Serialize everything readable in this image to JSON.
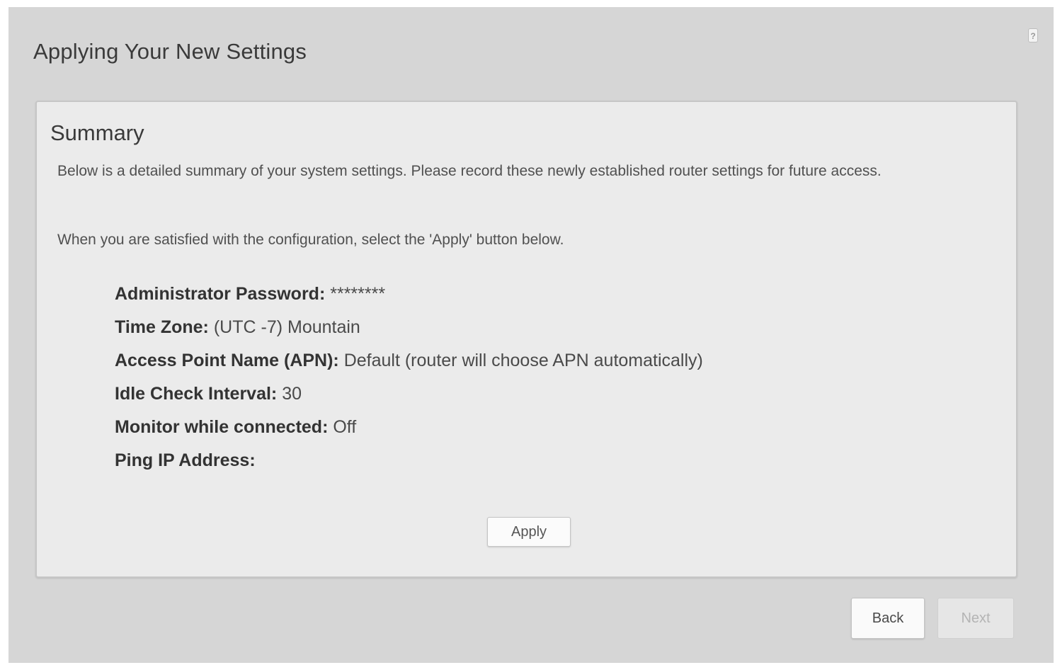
{
  "header": {
    "title": "Applying Your New Settings",
    "help_icon": "help-icon",
    "help_glyph": "?"
  },
  "summary": {
    "heading": "Summary",
    "paragraph_1": "Below is a detailed summary of your system settings. Please record these newly established router settings for future access.",
    "paragraph_2": "When you are satisfied with the configuration, select the 'Apply' button below.",
    "settings": [
      {
        "label": "Administrator Password:",
        "value": "********"
      },
      {
        "label": "Time Zone:",
        "value": "(UTC -7) Mountain"
      },
      {
        "label": "Access Point Name (APN):",
        "value": "Default (router will choose APN automatically)"
      },
      {
        "label": "Idle Check Interval:",
        "value": "30"
      },
      {
        "label": "Monitor while connected:",
        "value": "Off"
      },
      {
        "label": "Ping IP Address:",
        "value": ""
      }
    ],
    "apply_label": "Apply"
  },
  "footer": {
    "back_label": "Back",
    "next_label": "Next",
    "next_disabled": true
  }
}
